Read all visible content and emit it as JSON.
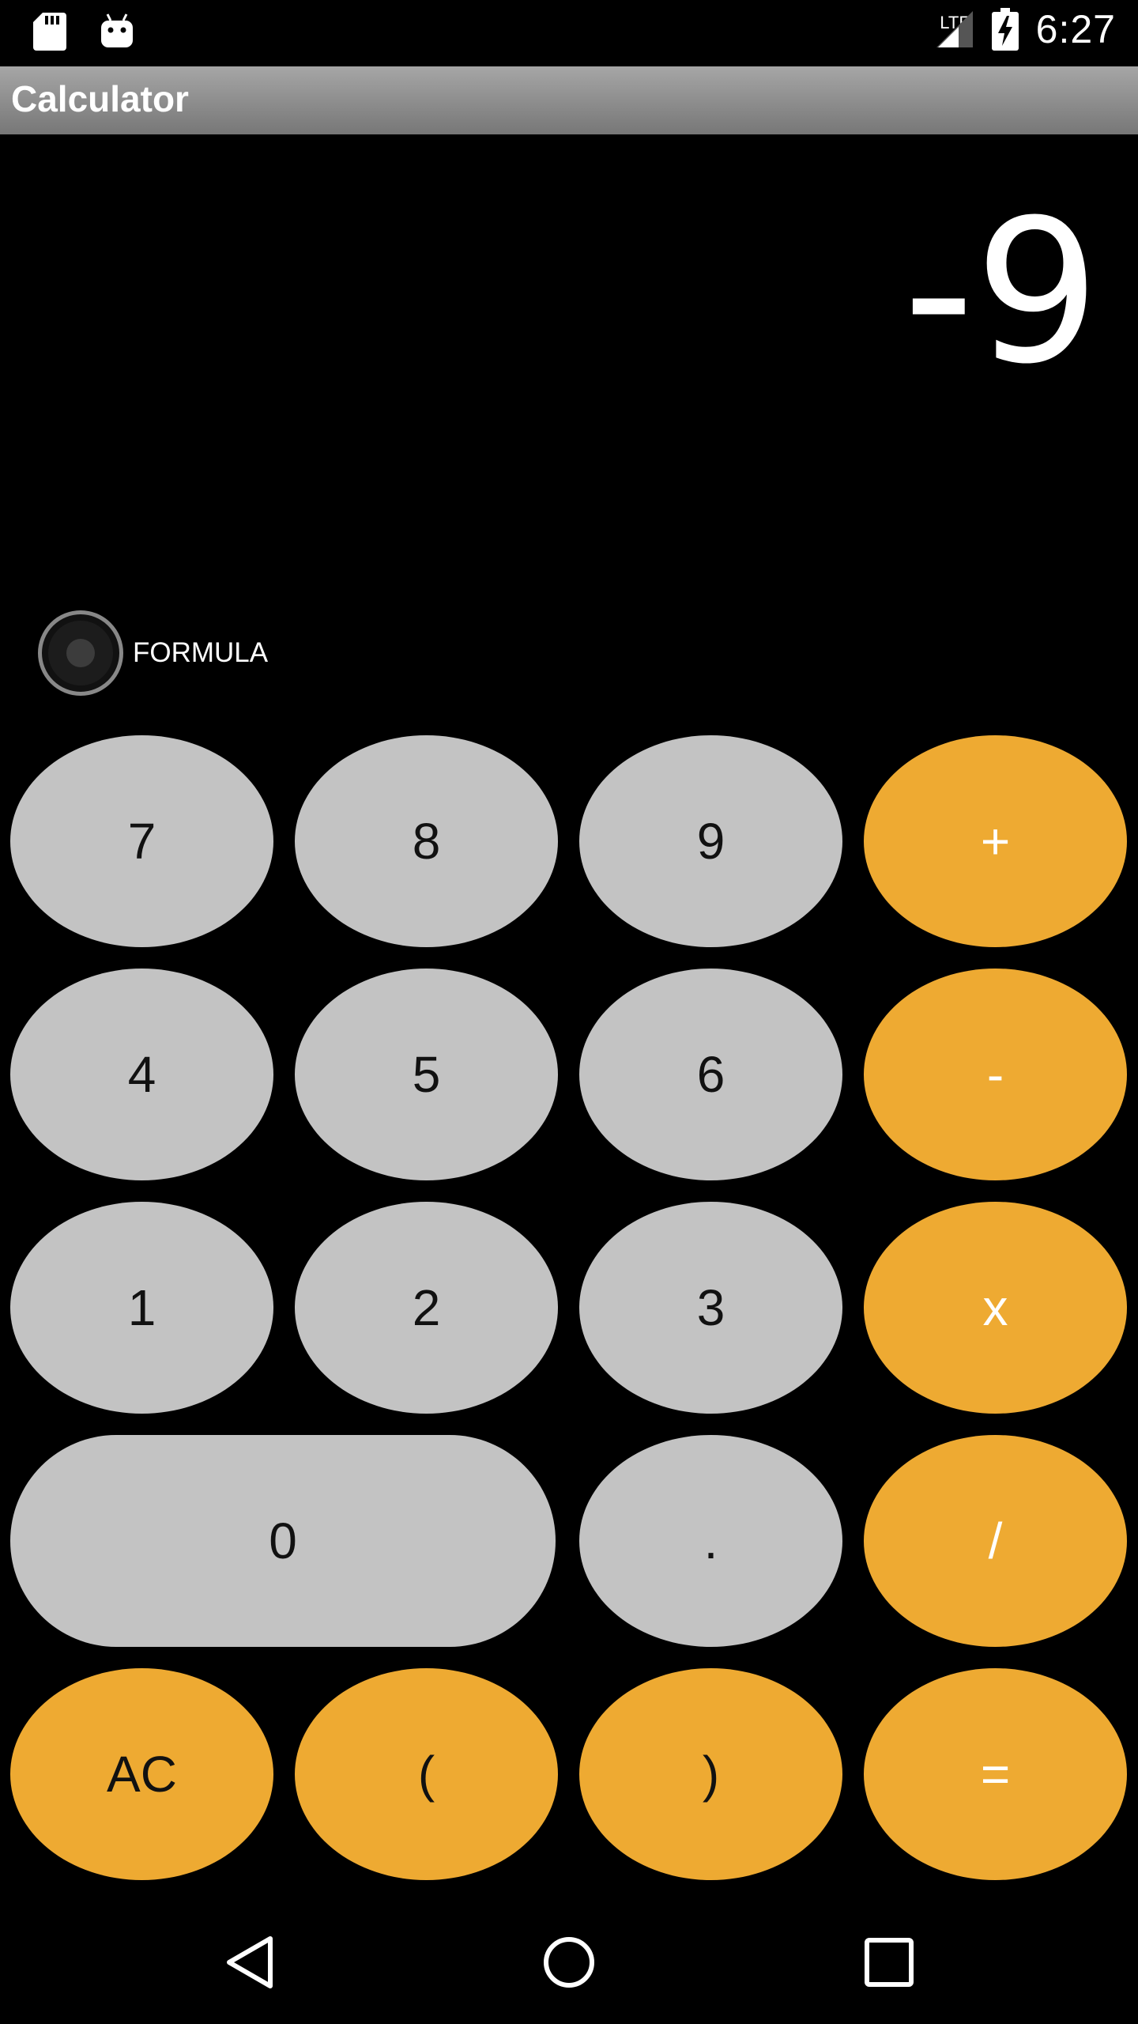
{
  "status_bar": {
    "time": "6:27",
    "network": "LTE",
    "icons": [
      "sd-card-icon",
      "android-debug-icon",
      "cell-signal-icon",
      "battery-charging-icon"
    ]
  },
  "app_bar": {
    "title": "Calculator"
  },
  "display": {
    "value": "-9"
  },
  "formula_toggle": {
    "label": "FORMULA",
    "checked": false
  },
  "keypad": {
    "num_color": "#c3c3c3",
    "op_color": "#eeaa32",
    "rows": [
      [
        "7",
        "8",
        "9",
        "+"
      ],
      [
        "4",
        "5",
        "6",
        "-"
      ],
      [
        "1",
        "2",
        "3",
        "x"
      ],
      [
        "0",
        ".",
        "/"
      ],
      [
        "AC",
        "(",
        ")",
        "="
      ]
    ]
  },
  "nav_bar": {
    "icons": [
      "back-icon",
      "home-icon",
      "recents-icon"
    ]
  }
}
